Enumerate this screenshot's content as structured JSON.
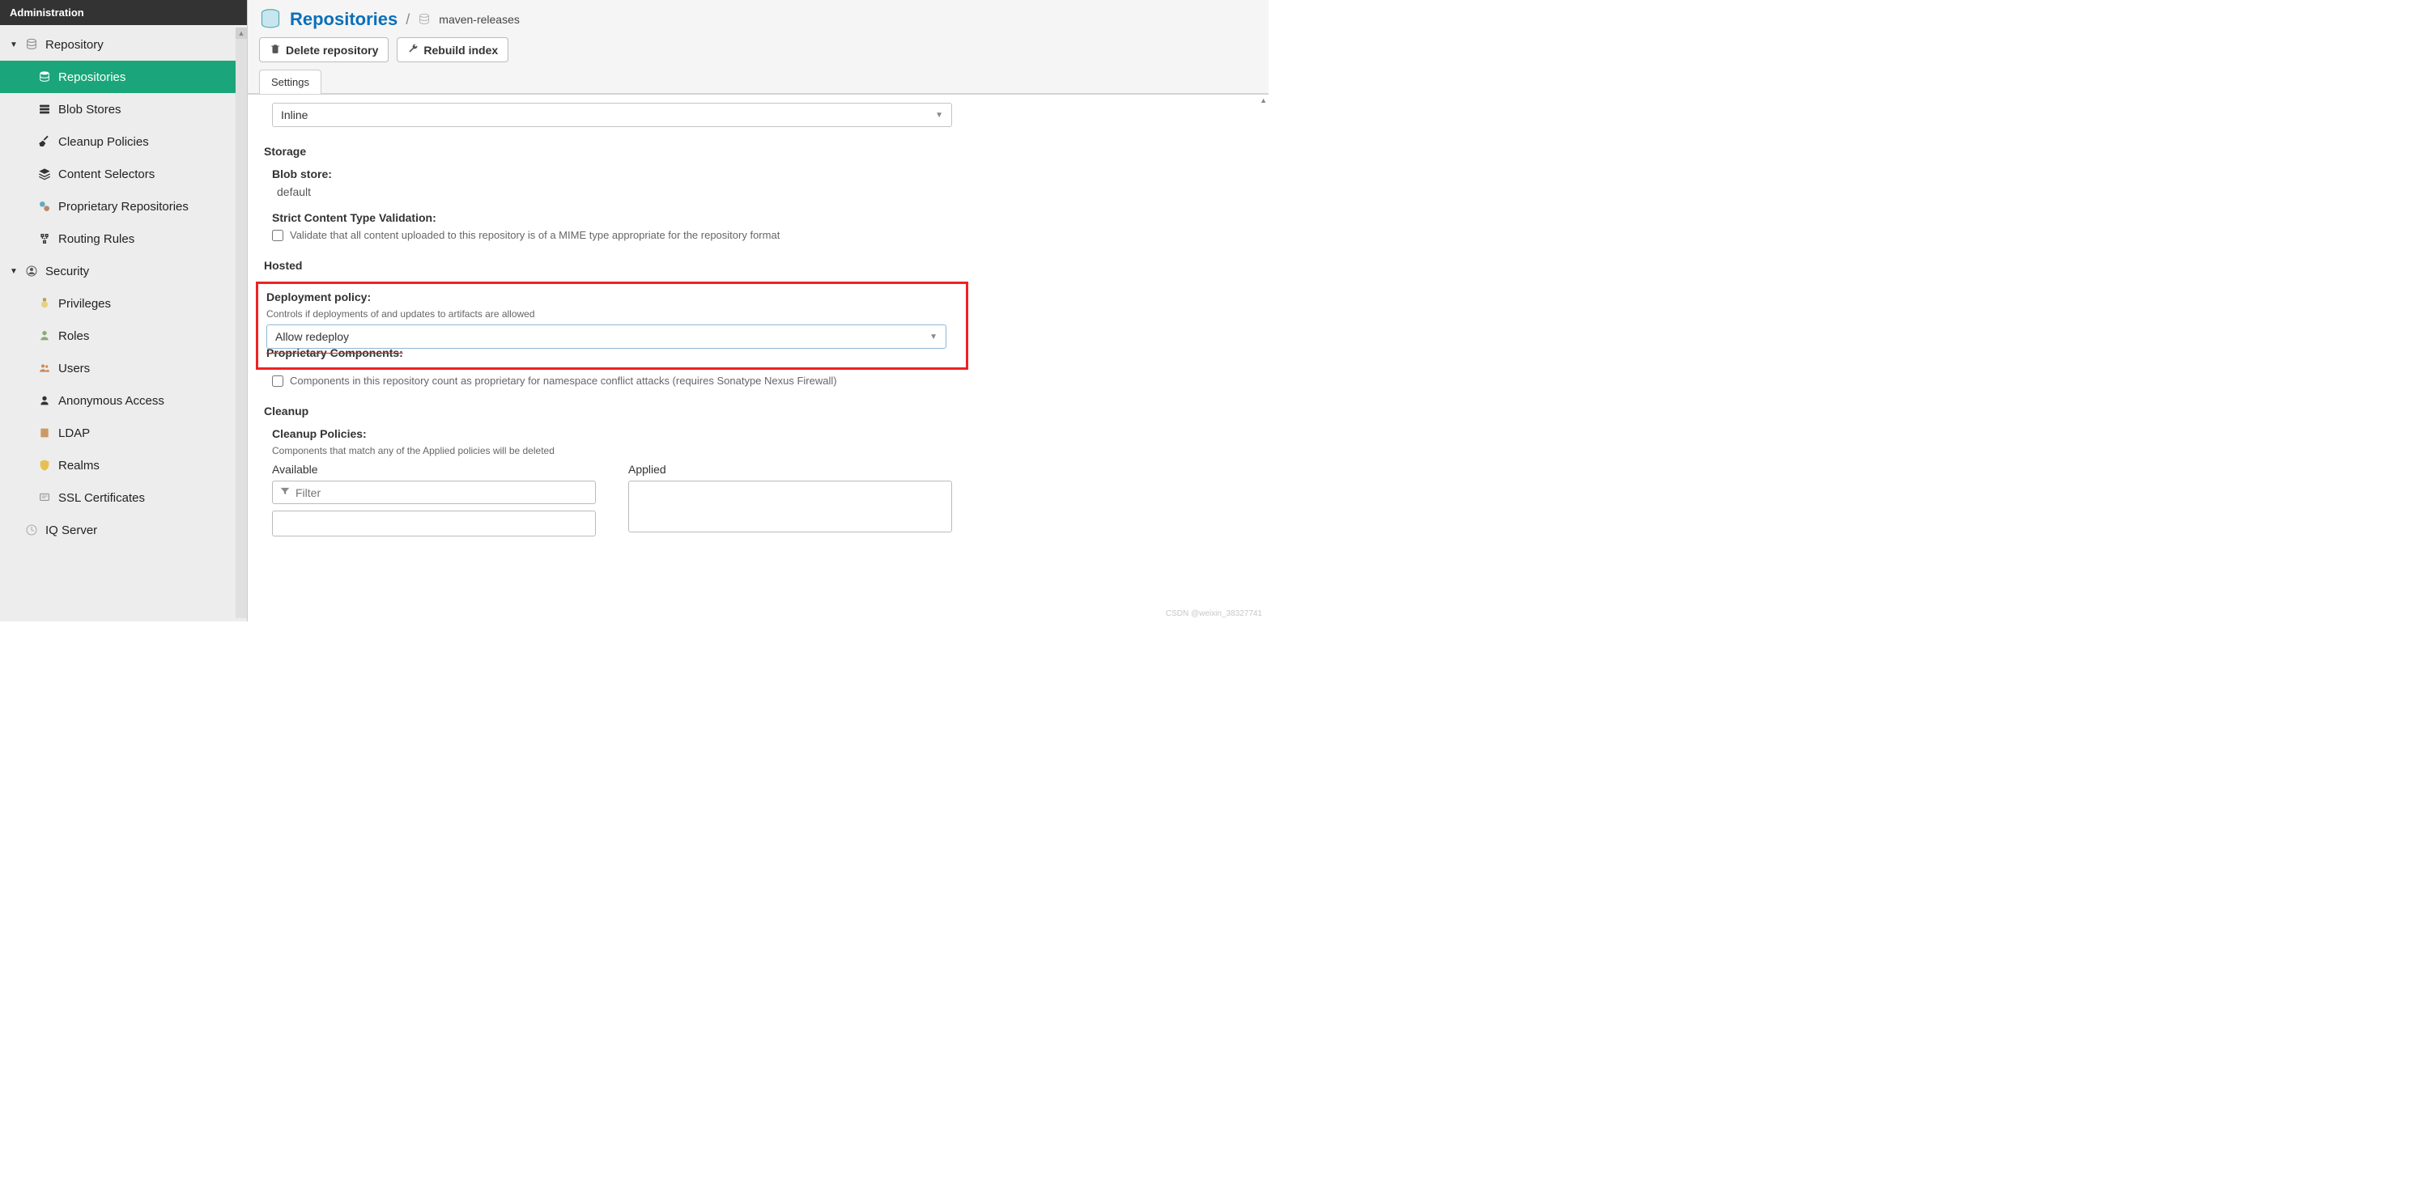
{
  "topbar": {
    "title": "Administration"
  },
  "sidebar": {
    "repository_group": "Repository",
    "items": [
      {
        "label": "Repositories"
      },
      {
        "label": "Blob Stores"
      },
      {
        "label": "Cleanup Policies"
      },
      {
        "label": "Content Selectors"
      },
      {
        "label": "Proprietary Repositories"
      },
      {
        "label": "Routing Rules"
      }
    ],
    "security_group": "Security",
    "security_items": [
      {
        "label": "Privileges"
      },
      {
        "label": "Roles"
      },
      {
        "label": "Users"
      },
      {
        "label": "Anonymous Access"
      },
      {
        "label": "LDAP"
      },
      {
        "label": "Realms"
      },
      {
        "label": "SSL Certificates"
      }
    ],
    "iq_server": "IQ Server"
  },
  "breadcrumb": {
    "title": "Repositories",
    "current": "maven-releases"
  },
  "toolbar": {
    "delete_label": "Delete repository",
    "rebuild_label": "Rebuild index"
  },
  "tabs": {
    "settings": "Settings"
  },
  "form": {
    "disposition_select": "Inline",
    "storage_section": "Storage",
    "blob_store_label": "Blob store:",
    "blob_store_value": "default",
    "strict_label": "Strict Content Type Validation:",
    "strict_help": "Validate that all content uploaded to this repository is of a MIME type appropriate for the repository format",
    "hosted_section": "Hosted",
    "deploy_label": "Deployment policy:",
    "deploy_help": "Controls if deployments of and updates to artifacts are allowed",
    "deploy_value": "Allow redeploy",
    "proprietary_label": "Proprietary Components:",
    "proprietary_help": "Components in this repository count as proprietary for namespace conflict attacks (requires Sonatype Nexus Firewall)",
    "cleanup_section": "Cleanup",
    "cleanup_label": "Cleanup Policies:",
    "cleanup_help": "Components that match any of the Applied policies will be deleted",
    "available_col": "Available",
    "applied_col": "Applied",
    "filter_placeholder": "Filter"
  },
  "watermark": "CSDN @weixin_38327741"
}
